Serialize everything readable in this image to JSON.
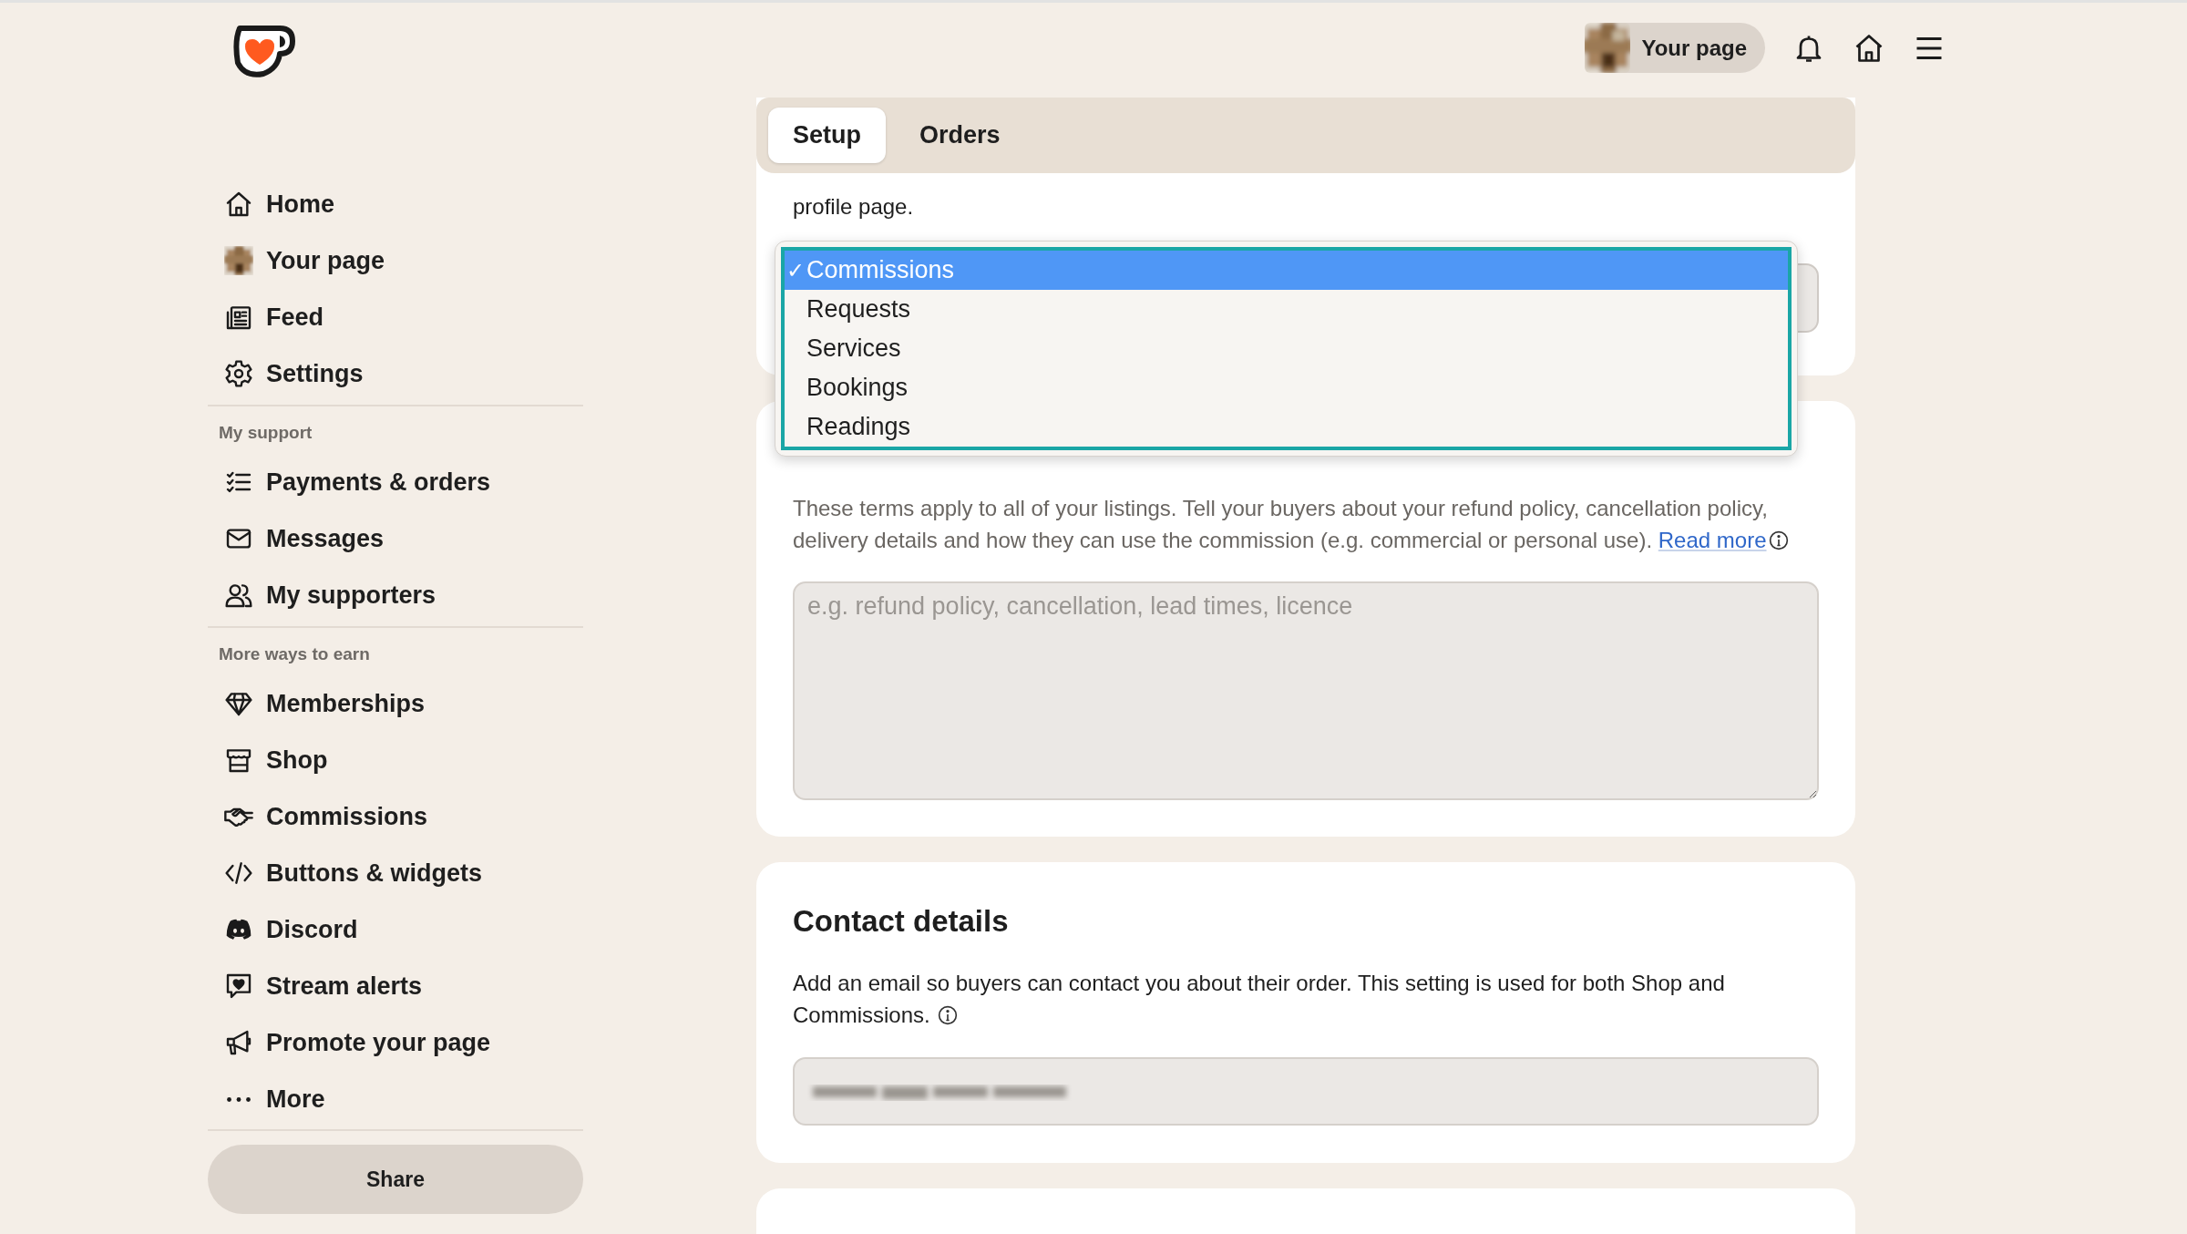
{
  "header": {
    "profile_button": "Your page"
  },
  "sidebar": {
    "sections": [
      {
        "items": [
          {
            "label": "Home"
          },
          {
            "label": "Your page"
          },
          {
            "label": "Feed"
          },
          {
            "label": "Settings"
          }
        ]
      },
      {
        "heading": "My support",
        "items": [
          {
            "label": "Payments & orders"
          },
          {
            "label": "Messages"
          },
          {
            "label": "My supporters"
          }
        ]
      },
      {
        "heading": "More ways to earn",
        "items": [
          {
            "label": "Memberships"
          },
          {
            "label": "Shop"
          },
          {
            "label": "Commissions"
          },
          {
            "label": "Buttons & widgets"
          },
          {
            "label": "Discord"
          },
          {
            "label": "Stream alerts"
          },
          {
            "label": "Promote your page"
          },
          {
            "label": "More"
          }
        ]
      }
    ],
    "share_button": "Share"
  },
  "tabs": [
    {
      "label": "Setup",
      "selected": true
    },
    {
      "label": "Orders",
      "selected": false
    }
  ],
  "wording": {
    "description": "profile page.",
    "dropdown": {
      "check_mark": "✓",
      "options": [
        {
          "label": "Commissions",
          "selected": true
        },
        {
          "label": "Requests",
          "selected": false
        },
        {
          "label": "Services",
          "selected": false
        },
        {
          "label": "Bookings",
          "selected": false
        },
        {
          "label": "Readings",
          "selected": false
        }
      ]
    }
  },
  "terms": {
    "description": "These terms apply to all of your listings. Tell your buyers about your refund policy, cancellation policy, delivery details and how they can use the commission (e.g. commercial or personal use).",
    "link": "Read more",
    "placeholder": "e.g. refund policy, cancellation, lead times, licence"
  },
  "contact": {
    "title": "Contact details",
    "description": "Add an email so buyers can contact you about their order. This setting is used for both Shop and Commissions."
  }
}
